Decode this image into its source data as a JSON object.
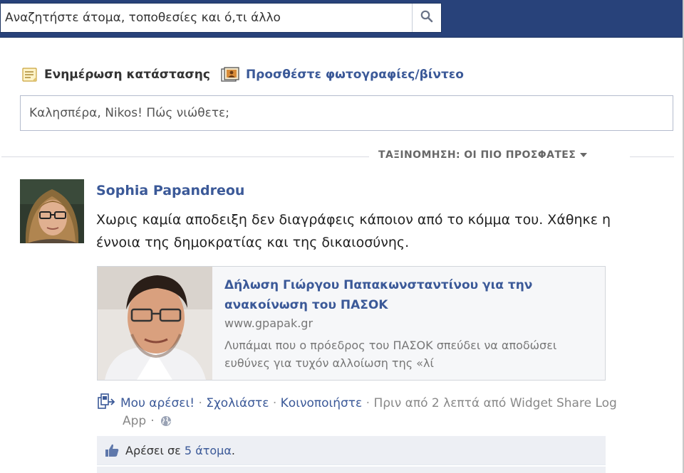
{
  "search": {
    "placeholder": "Αναζητήστε άτομα, τοποθεσίες και ό,τι άλλο",
    "icon": "search-icon"
  },
  "composer": {
    "tabs": [
      {
        "label": "Ενημέρωση κατάστασης",
        "icon": "status-note-icon"
      },
      {
        "label": "Προσθέστε φωτογραφίες/βίντεο",
        "icon": "photo-video-icon"
      }
    ],
    "placeholder": "Καλησπέρα, Nikos! Πώς νιώθετε;"
  },
  "sort": {
    "label": "ΤΑΞΙΝΟΜΗΣΗ: ΟΙ ΠΙΟ ΠΡΟΣΦΑΤΕΣ"
  },
  "post": {
    "author": "Sophia Papandreou",
    "text": "Χωρις καμία αποδειξη δεν διαγράφεις κάποιον από το κόμμα του. Χάθηκε η έννοια της δημοκρατίας και της δικαιοσύνης.",
    "attachment": {
      "title": "Δήλωση Γιώργου Παπακωνσταντίνου για την ανακοίνωση του ΠΑΣΟΚ",
      "domain": "www.gpapak.gr",
      "description": "Λυπάμαι που ο πρόεδρος του ΠΑΣΟΚ σπεύδει να αποδώσει ευθύνες για τυχόν αλλοίωση της «λί"
    },
    "actions": {
      "like": "Μου αρέσει!",
      "comment": "Σχολιάστε",
      "share": "Κοινοποιήστε",
      "separator": "·",
      "timestamp_prefix": "Πριν από 2 λεπτά από ",
      "via_app": "Widget Share Log",
      "app_suffix": "App"
    },
    "likes": {
      "prefix": "Αρέσει σε ",
      "count_label": "5 άτομα",
      "suffix": "."
    }
  },
  "colors": {
    "topbar": "#28427a",
    "link": "#3b5998",
    "likes_bg": "#edeff4"
  }
}
